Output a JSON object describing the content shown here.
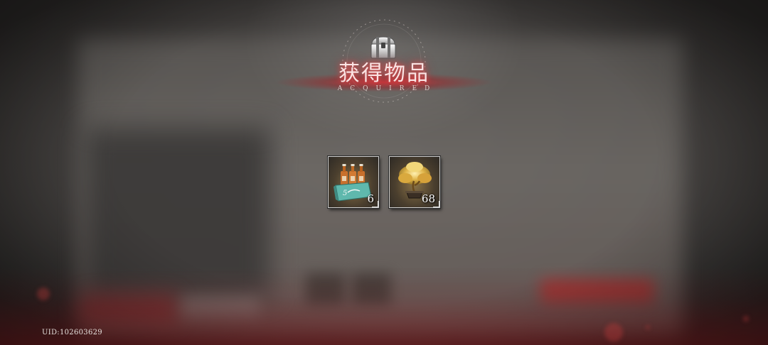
{
  "header": {
    "title": "获得物品",
    "subtitle": "ACQUIRED",
    "icon": "treasure-chest-icon"
  },
  "items": [
    {
      "name": "drink-bottle-pack",
      "count": "6",
      "icon": "bottle-crate-icon"
    },
    {
      "name": "golden-bonsai-tree",
      "count": "68",
      "icon": "gold-tree-icon"
    }
  ],
  "footer": {
    "uid": "UID:102603629"
  },
  "colors": {
    "accent_red": "#c8323a",
    "title_glow": "#ff5050",
    "item_border": "#cfcfcf"
  }
}
